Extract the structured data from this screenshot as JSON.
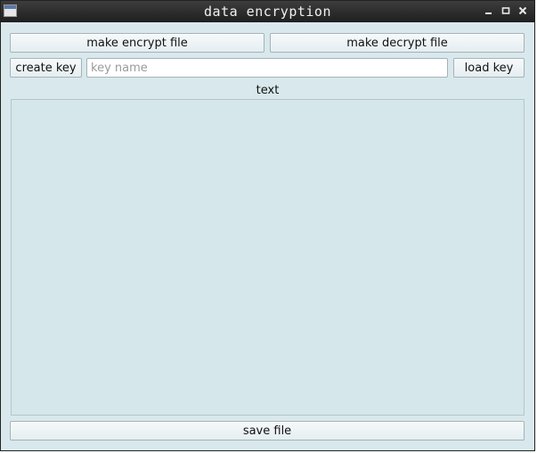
{
  "window": {
    "title": "data encryption",
    "controls": [
      "minimize-icon",
      "maximize-icon",
      "close-icon"
    ]
  },
  "toolbar": {
    "encrypt_label": "make encrypt file",
    "decrypt_label": "make decrypt file"
  },
  "key_row": {
    "create_label": "create key",
    "key_name_value": "",
    "key_name_placeholder": "key name",
    "load_label": "load key"
  },
  "text_section": {
    "label": "text",
    "content": ""
  },
  "footer": {
    "save_label": "save file"
  },
  "colors": {
    "titlebar": "#2b2b2b",
    "window_bg": "#d9e8ec",
    "text_area_bg": "#d5e7eb"
  }
}
